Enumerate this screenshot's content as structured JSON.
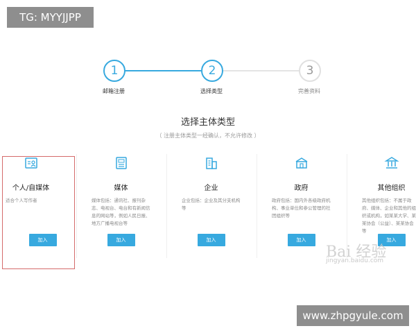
{
  "overlays": {
    "tag_top": "TG: MYYJJPP",
    "tag_bottom": "www.zhpgyule.com"
  },
  "steps": [
    {
      "number": "1",
      "label": "邮箱注册",
      "state": "active"
    },
    {
      "number": "2",
      "label": "选择类型",
      "state": "active"
    },
    {
      "number": "3",
      "label": "完善资料",
      "state": "pending"
    }
  ],
  "heading": {
    "title": "选择主体类型",
    "subtitle": "（ 注册主体类型一经确认，不允许修改 ）"
  },
  "cards": [
    {
      "name": "个人/自媒体",
      "icon": "id-card-icon",
      "desc": "适合个人写作者",
      "button": "加入"
    },
    {
      "name": "媒体",
      "icon": "newspaper-icon",
      "desc": "媒体包括：通讯社、报刊杂志、电视台、电台和有新闻信息的网站等，例如人民日报、地方广播电视台等",
      "button": "加入"
    },
    {
      "name": "企业",
      "icon": "building-icon",
      "desc": "企业包括：企业及其分支机构等",
      "button": "加入"
    },
    {
      "name": "政府",
      "icon": "government-icon",
      "desc": "政府包括：国内外各级政府机构、事业单位和参公管理的社团组织等",
      "button": "加入"
    },
    {
      "name": "其他组织",
      "icon": "institution-icon",
      "desc": "其他组织包括：不属于政府、媒体、企业和其他的组织或机构，如某某大学、某某协会（公益）、某某协会等",
      "button": "加入"
    }
  ],
  "watermark": {
    "main": "Bai 经验",
    "sub": "jingyan.baidu.com"
  },
  "colors": {
    "accent": "#37a9df",
    "highlight": "#d46a6a"
  }
}
